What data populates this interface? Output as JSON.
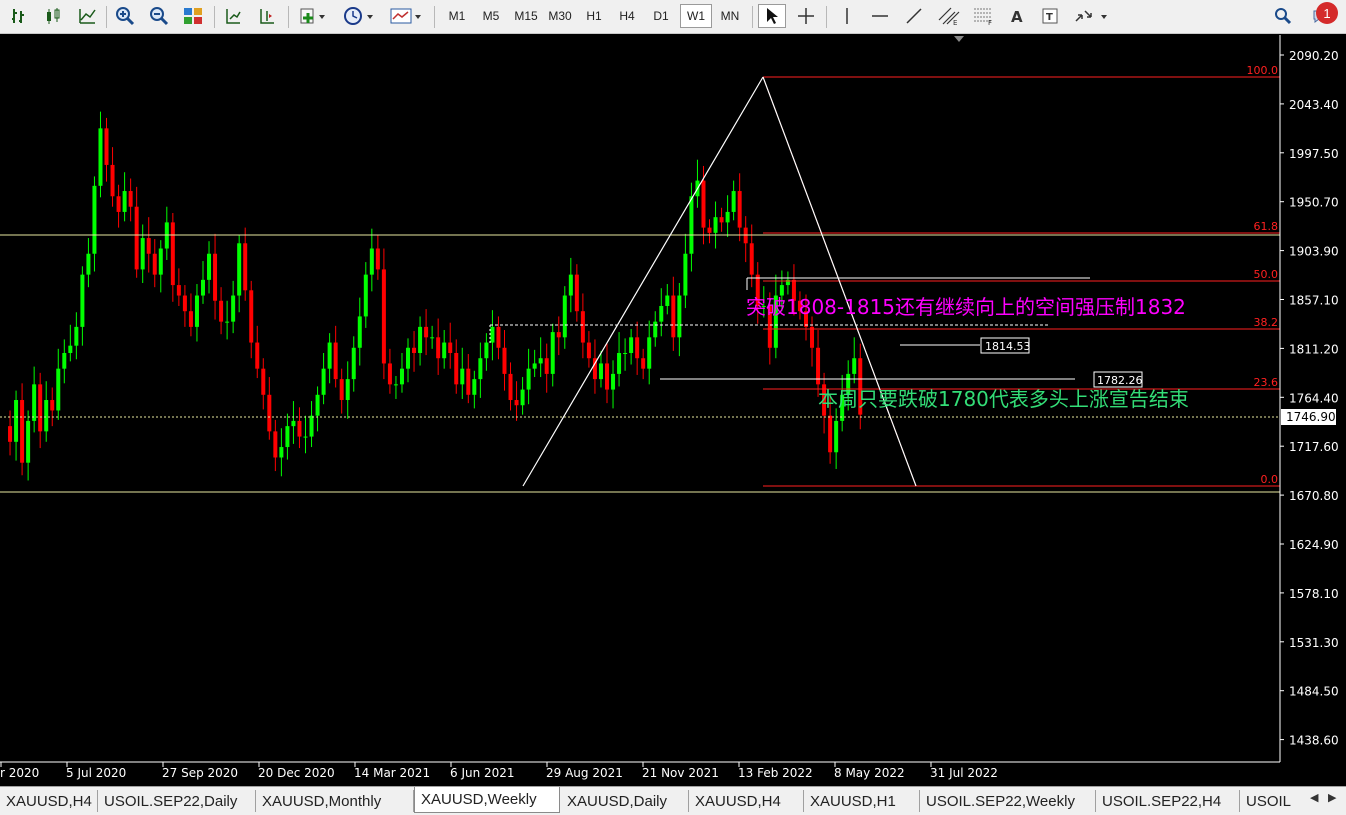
{
  "toolbar": {
    "timeframes": [
      "M1",
      "M5",
      "M15",
      "M30",
      "H1",
      "H4",
      "D1",
      "W1",
      "MN"
    ],
    "active_timeframe": "W1",
    "notification_count": "1"
  },
  "chart": {
    "symbol": "XAUUSD",
    "timeframe": "Weekly",
    "price_axis": [
      "2090.20",
      "2043.40",
      "1997.50",
      "1950.70",
      "1903.90",
      "1857.10",
      "1811.20",
      "1764.40",
      "1717.60",
      "1670.80",
      "1624.90",
      "1578.10",
      "1531.30",
      "1484.50",
      "1438.60"
    ],
    "date_axis": [
      "r 2020",
      "5 Jul 2020",
      "27 Sep 2020",
      "20 Dec 2020",
      "14 Mar 2021",
      "6 Jun 2021",
      "29 Aug 2021",
      "21 Nov 2021",
      "13 Feb 2022",
      "8 May 2022",
      "31 Jul 2022"
    ],
    "current_price": "1746.90",
    "price_labels": [
      "1814.53",
      "1782.26"
    ],
    "fib_levels": [
      "100.0",
      "61.8",
      "50.0",
      "38.2",
      "23.6",
      "0.0"
    ],
    "annotations": {
      "top": "突破1808-1815还有继续向上的空间强压制1832",
      "bottom": "本周只要跌破1780代表多头上涨宣告结束"
    },
    "colors": {
      "bull": "#00ff00",
      "bear": "#ff0000",
      "fib": "#ff2020",
      "hline": "#e8e8a0",
      "annotation_top": "#ff00ff",
      "annotation_bottom": "#33dd77"
    }
  },
  "tabs": [
    "XAUUSD,H4",
    "USOIL.SEP22,Daily",
    "XAUUSD,Monthly",
    "XAUUSD,Weekly",
    "XAUUSD,Daily",
    "XAUUSD,H4",
    "XAUUSD,H1",
    "USOIL.SEP22,Weekly",
    "USOIL.SEP22,H4",
    "USOIL"
  ],
  "active_tab": "XAUUSD,Weekly"
}
